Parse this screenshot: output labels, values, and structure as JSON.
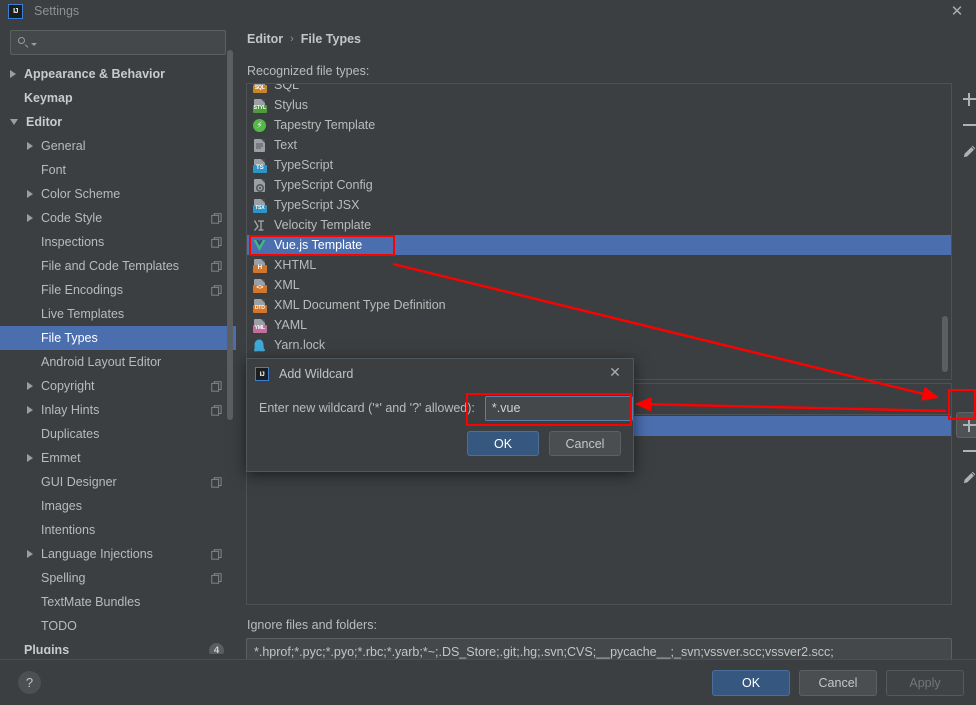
{
  "window": {
    "title": "Settings",
    "logo_text": "IJ",
    "close_icon": "✕"
  },
  "sidebar": {
    "search": {
      "value": "",
      "placeholder": ""
    },
    "items": [
      {
        "label": "Appearance & Behavior",
        "indent": 0,
        "twisty": "closed",
        "bold": true,
        "badge": "",
        "selected": false
      },
      {
        "label": "Keymap",
        "indent": 0,
        "twisty": "none",
        "bold": true,
        "badge": "",
        "selected": false
      },
      {
        "label": "Editor",
        "indent": 0,
        "twisty": "open",
        "bold": true,
        "badge": "",
        "selected": false
      },
      {
        "label": "General",
        "indent": 1,
        "twisty": "closed",
        "bold": false,
        "badge": "",
        "selected": false
      },
      {
        "label": "Font",
        "indent": 1,
        "twisty": "none",
        "bold": false,
        "badge": "",
        "selected": false
      },
      {
        "label": "Color Scheme",
        "indent": 1,
        "twisty": "closed",
        "bold": false,
        "badge": "",
        "selected": false
      },
      {
        "label": "Code Style",
        "indent": 1,
        "twisty": "closed",
        "bold": false,
        "badge": "copy",
        "selected": false
      },
      {
        "label": "Inspections",
        "indent": 1,
        "twisty": "none",
        "bold": false,
        "badge": "copy",
        "selected": false
      },
      {
        "label": "File and Code Templates",
        "indent": 1,
        "twisty": "none",
        "bold": false,
        "badge": "copy",
        "selected": false
      },
      {
        "label": "File Encodings",
        "indent": 1,
        "twisty": "none",
        "bold": false,
        "badge": "copy",
        "selected": false
      },
      {
        "label": "Live Templates",
        "indent": 1,
        "twisty": "none",
        "bold": false,
        "badge": "",
        "selected": false
      },
      {
        "label": "File Types",
        "indent": 1,
        "twisty": "none",
        "bold": false,
        "badge": "",
        "selected": true
      },
      {
        "label": "Android Layout Editor",
        "indent": 1,
        "twisty": "none",
        "bold": false,
        "badge": "",
        "selected": false
      },
      {
        "label": "Copyright",
        "indent": 1,
        "twisty": "closed",
        "bold": false,
        "badge": "copy",
        "selected": false
      },
      {
        "label": "Inlay Hints",
        "indent": 1,
        "twisty": "closed",
        "bold": false,
        "badge": "copy",
        "selected": false
      },
      {
        "label": "Duplicates",
        "indent": 1,
        "twisty": "none",
        "bold": false,
        "badge": "",
        "selected": false
      },
      {
        "label": "Emmet",
        "indent": 1,
        "twisty": "closed",
        "bold": false,
        "badge": "",
        "selected": false
      },
      {
        "label": "GUI Designer",
        "indent": 1,
        "twisty": "none",
        "bold": false,
        "badge": "copy",
        "selected": false
      },
      {
        "label": "Images",
        "indent": 1,
        "twisty": "none",
        "bold": false,
        "badge": "",
        "selected": false
      },
      {
        "label": "Intentions",
        "indent": 1,
        "twisty": "none",
        "bold": false,
        "badge": "",
        "selected": false
      },
      {
        "label": "Language Injections",
        "indent": 1,
        "twisty": "closed",
        "bold": false,
        "badge": "copy",
        "selected": false
      },
      {
        "label": "Spelling",
        "indent": 1,
        "twisty": "none",
        "bold": false,
        "badge": "copy",
        "selected": false
      },
      {
        "label": "TextMate Bundles",
        "indent": 1,
        "twisty": "none",
        "bold": false,
        "badge": "",
        "selected": false
      },
      {
        "label": "TODO",
        "indent": 1,
        "twisty": "none",
        "bold": false,
        "badge": "",
        "selected": false
      },
      {
        "label": "Plugins",
        "indent": 0,
        "twisty": "none",
        "bold": true,
        "badge": "4",
        "selected": false
      }
    ]
  },
  "main": {
    "breadcrumb": {
      "parent": "Editor",
      "separator": "›",
      "current": "File Types"
    },
    "recognized_label": "Recognized file types:",
    "file_types": [
      {
        "label": "SQL",
        "icon": "sql-file-icon",
        "kind": "tag",
        "tag": "SQL",
        "tag_color": "#c8862a",
        "selected": false,
        "clipped": true
      },
      {
        "label": "Stylus",
        "icon": "stylus-file-icon",
        "kind": "tag",
        "tag": "STYL",
        "tag_color": "#4f9a3e",
        "selected": false
      },
      {
        "label": "Tapestry Template",
        "icon": "tapestry-template-icon",
        "kind": "circle",
        "tag": "⚡",
        "tag_color": "#55b848",
        "selected": false
      },
      {
        "label": "Text",
        "icon": "text-file-icon",
        "kind": "plain",
        "tag": "",
        "tag_color": "",
        "selected": false
      },
      {
        "label": "TypeScript",
        "icon": "typescript-file-icon",
        "kind": "tag",
        "tag": "TS",
        "tag_color": "#2b95c9",
        "selected": false
      },
      {
        "label": "TypeScript Config",
        "icon": "typescript-config-icon",
        "kind": "gear",
        "tag": "",
        "tag_color": "",
        "selected": false
      },
      {
        "label": "TypeScript JSX",
        "icon": "typescript-jsx-file-icon",
        "kind": "tag",
        "tag": "TSX",
        "tag_color": "#2b95c9",
        "selected": false
      },
      {
        "label": "Velocity Template",
        "icon": "velocity-template-icon",
        "kind": "vtl",
        "tag": "",
        "tag_color": "",
        "selected": false
      },
      {
        "label": "Vue.js Template",
        "icon": "vuejs-template-icon",
        "kind": "vue",
        "tag": "V",
        "tag_color": "#42b883",
        "selected": true
      },
      {
        "label": "XHTML",
        "icon": "xhtml-file-icon",
        "kind": "tag",
        "tag": "H",
        "tag_color": "#d4762a",
        "selected": false
      },
      {
        "label": "XML",
        "icon": "xml-file-icon",
        "kind": "tag",
        "tag": "<>",
        "tag_color": "#d4762a",
        "selected": false
      },
      {
        "label": "XML Document Type Definition",
        "icon": "dtd-file-icon",
        "kind": "tag",
        "tag": "DTD",
        "tag_color": "#d4762a",
        "selected": false
      },
      {
        "label": "YAML",
        "icon": "yaml-file-icon",
        "kind": "tag",
        "tag": "YML",
        "tag_color": "#c26ea0",
        "selected": false
      },
      {
        "label": "Yarn.lock",
        "icon": "yarn-lock-file-icon",
        "kind": "yarn",
        "tag": "",
        "tag_color": "#3fa9d8",
        "selected": false
      }
    ],
    "list_toolbar": [
      {
        "name": "add-file-type-button",
        "glyph": "plus"
      },
      {
        "name": "remove-file-type-button",
        "glyph": "minus"
      },
      {
        "name": "edit-file-type-button",
        "glyph": "pencil"
      }
    ],
    "pattern_toolbar": [
      {
        "name": "add-pattern-button",
        "glyph": "plus",
        "highlighted": true
      },
      {
        "name": "remove-pattern-button",
        "glyph": "minus",
        "highlighted": false
      },
      {
        "name": "edit-pattern-button",
        "glyph": "pencil",
        "highlighted": false
      }
    ],
    "ignore_label": "Ignore files and folders:",
    "ignore_value": "*.hprof;*.pyc;*.pyo;*.rbc;*.yarb;*~;.DS_Store;.git;.hg;.svn;CVS;__pycache__;_svn;vssver.scc;vssver2.scc;"
  },
  "modal": {
    "logo_text": "IJ",
    "title": "Add Wildcard",
    "close_icon": "✕",
    "prompt": "Enter new wildcard ('*' and '?' allowed):",
    "input_value": "*.vue",
    "input_placeholder": "",
    "ok_label": "OK",
    "cancel_label": "Cancel"
  },
  "footer": {
    "help_label": "?",
    "ok_label": "OK",
    "cancel_label": "Cancel",
    "apply_label": "Apply"
  },
  "colors": {
    "background": "#3c3f41",
    "selection": "#4b6eaf",
    "primary_button": "#365880",
    "annotation": "#ff0000",
    "text": "#bbbbbb"
  }
}
